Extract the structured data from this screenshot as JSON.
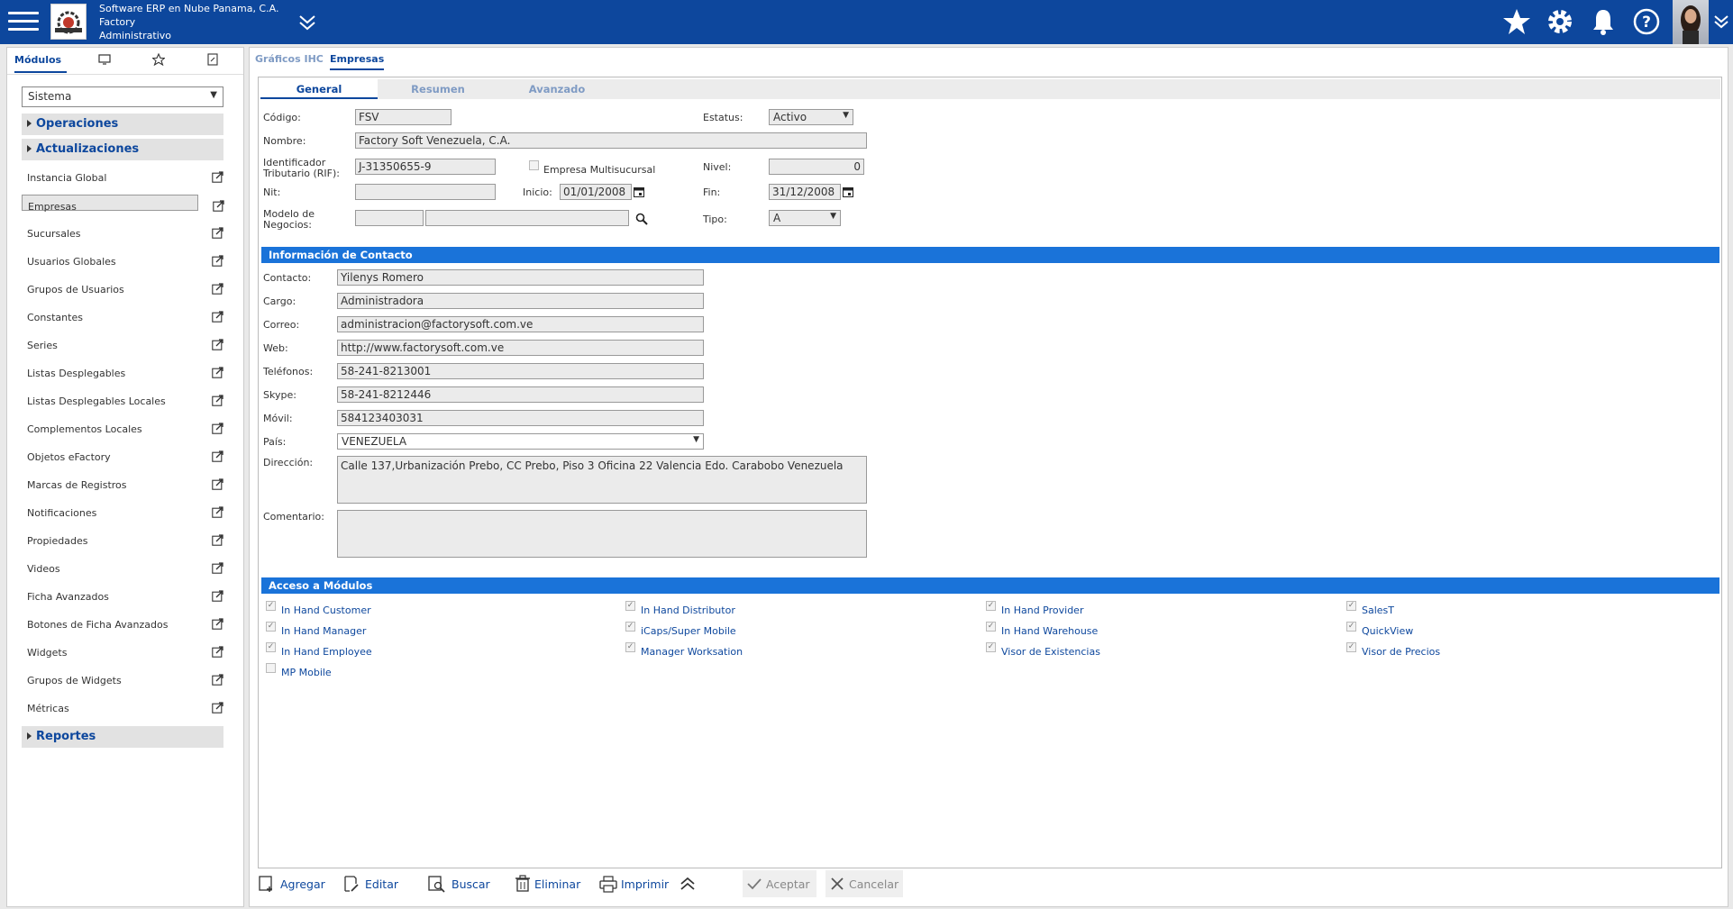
{
  "header": {
    "company_line1": "Software ERP en Nube Panama, C.A.",
    "company_line2": "Factory",
    "company_line3": "Administrativo",
    "icons": [
      "menu-icon",
      "double-chevron-down-icon",
      "star-icon",
      "gear-icon",
      "bell-icon",
      "help-icon",
      "chevron-down-icon"
    ],
    "brand_color": "#0d479d"
  },
  "sidebar": {
    "tabs": [
      {
        "label": "Módulos"
      },
      {
        "icon": "monitor-icon"
      },
      {
        "icon": "star-outline-icon"
      },
      {
        "icon": "document-icon"
      }
    ],
    "module_select": "Sistema",
    "groups": {
      "operaciones": "Operaciones",
      "actualizaciones": "Actualizaciones",
      "reportes": "Reportes"
    },
    "items": [
      "Instancia Global",
      "Empresas",
      "Sucursales",
      "Usuarios Globales",
      "Grupos de Usuarios",
      "Constantes",
      "Series",
      "Listas Desplegables",
      "Listas Desplegables Locales",
      "Complementos Locales",
      "Objetos eFactory",
      "Marcas de Registros",
      "Notificaciones",
      "Propiedades",
      "Videos",
      "Ficha Avanzados",
      "Botones de Ficha Avanzados",
      "Widgets",
      "Grupos de Widgets",
      "Métricas"
    ],
    "selected_item": "Empresas"
  },
  "main": {
    "tabs": [
      "Gráficos IHC",
      "Empresas"
    ],
    "subtabs": [
      "General",
      "Resumen",
      "Avanzado"
    ],
    "general": {
      "codigo_label": "Código:",
      "codigo": "FSV",
      "estatus_label": "Estatus:",
      "estatus": "Activo",
      "nombre_label": "Nombre:",
      "nombre": "Factory Soft Venezuela, C.A.",
      "rif_label_1": "Identificador",
      "rif_label_2": "Tributario (RIF):",
      "rif": "J-31350655-9",
      "multisucursal_label": "Empresa Multisucursal",
      "nivel_label": "Nivel:",
      "nivel": "0",
      "nit_label": "Nit:",
      "nit": "",
      "inicio_label": "Inicio:",
      "inicio": "01/01/2008",
      "fin_label": "Fin:",
      "fin": "31/12/2008",
      "modelo_label_1": "Modelo de",
      "modelo_label_2": "Negocios:",
      "tipo_label": "Tipo:",
      "tipo": "A"
    },
    "contacto": {
      "section_title": "Información de Contacto",
      "contacto_label": "Contacto:",
      "contacto": "Yilenys Romero",
      "cargo_label": "Cargo:",
      "cargo": "Administradora",
      "correo_label": "Correo:",
      "correo": "administracion@factorysoft.com.ve",
      "web_label": "Web:",
      "web": "http://www.factorysoft.com.ve",
      "telefonos_label": "Teléfonos:",
      "telefonos": "58-241-8213001",
      "skype_label": "Skype:",
      "skype": "58-241-8212446",
      "movil_label": "Móvil:",
      "movil": "584123403031",
      "pais_label": "País:",
      "pais": "VENEZUELA",
      "direccion_label": "Dirección:",
      "direccion": "Calle 137,Urbanización Prebo, CC Prebo, Piso 3 Oficina 22 Valencia Edo. Carabobo Venezuela",
      "comentario_label": "Comentario:",
      "comentario": ""
    },
    "modulos": {
      "section_title": "Acceso a Módulos",
      "items": [
        {
          "label": "In Hand Customer",
          "checked": true
        },
        {
          "label": "In Hand Distributor",
          "checked": true
        },
        {
          "label": "In Hand Provider",
          "checked": true
        },
        {
          "label": "SalesT",
          "checked": true
        },
        {
          "label": "In Hand Manager",
          "checked": true
        },
        {
          "label": "iCaps/Super Mobile",
          "checked": true
        },
        {
          "label": "In Hand Warehouse",
          "checked": true
        },
        {
          "label": "QuickView",
          "checked": true
        },
        {
          "label": "In Hand Employee",
          "checked": true
        },
        {
          "label": "Manager Worksation",
          "checked": true
        },
        {
          "label": "Visor de Existencias",
          "checked": true
        },
        {
          "label": "Visor de Precios",
          "checked": true
        },
        {
          "label": "MP Mobile",
          "checked": false
        }
      ]
    }
  },
  "toolbar": {
    "agregar": "Agregar",
    "editar": "Editar",
    "buscar": "Buscar",
    "eliminar": "Eliminar",
    "imprimir": "Imprimir",
    "aceptar": "Aceptar",
    "cancelar": "Cancelar"
  }
}
